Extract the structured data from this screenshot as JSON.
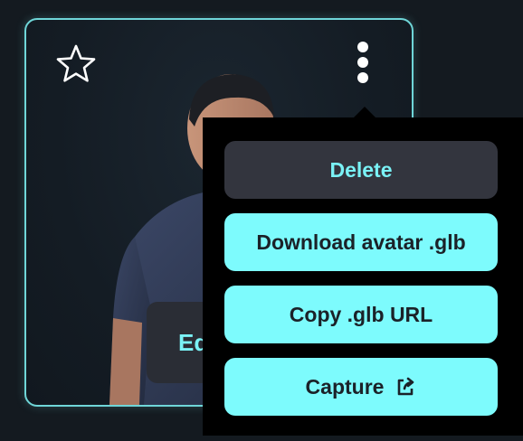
{
  "card": {
    "edit_label": "Ed",
    "favorite_icon": "star-outline-icon",
    "more_icon": "kebab-menu-icon"
  },
  "menu": {
    "items": [
      {
        "label": "Delete",
        "style": "dark"
      },
      {
        "label": "Download avatar .glb",
        "style": "light"
      },
      {
        "label": "Copy .glb URL",
        "style": "light"
      },
      {
        "label": "Capture",
        "style": "light",
        "icon": "share-external-icon"
      }
    ]
  },
  "colors": {
    "accent": "#7af2f6",
    "card_border": "#6fd6d8",
    "background": "#141a20",
    "menu_bg": "#000000",
    "dark_button": "#33353e"
  }
}
